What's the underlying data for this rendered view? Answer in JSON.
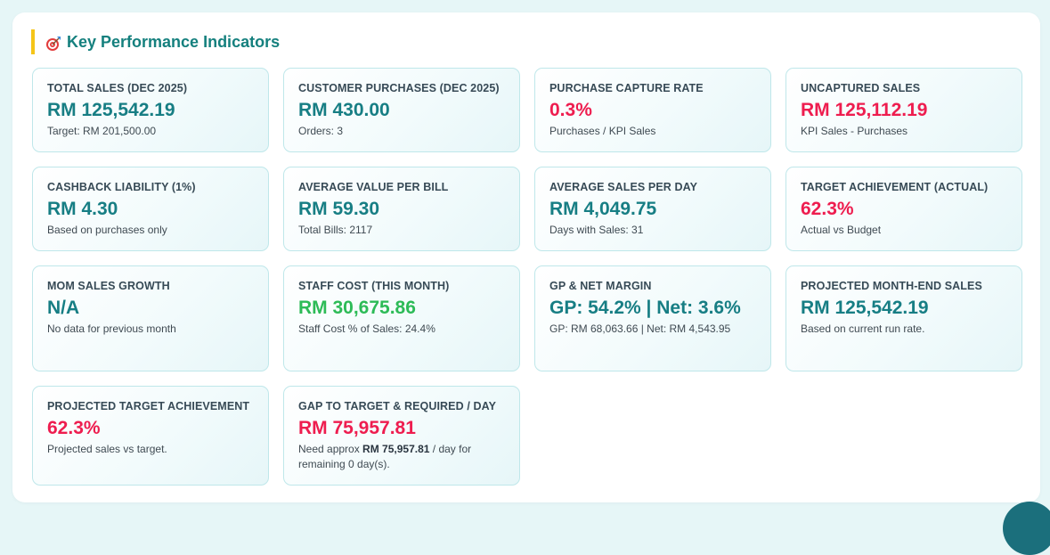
{
  "section": {
    "title": "Key Performance Indicators",
    "icon": "target-icon",
    "accent_color": "#f5c518"
  },
  "colors": {
    "teal": "#177e84",
    "red": "#ee1d4f",
    "green": "#2dbb57"
  },
  "cards": [
    {
      "label": "TOTAL SALES (DEC 2025)",
      "value": "RM 125,542.19",
      "sub": "Target: RM 201,500.00",
      "tone": "teal"
    },
    {
      "label": "CUSTOMER PURCHASES (DEC 2025)",
      "value": "RM 430.00",
      "sub": "Orders: 3",
      "tone": "teal"
    },
    {
      "label": "PURCHASE CAPTURE RATE",
      "value": "0.3%",
      "sub": "Purchases / KPI Sales",
      "tone": "red"
    },
    {
      "label": "UNCAPTURED SALES",
      "value": "RM 125,112.19",
      "sub": "KPI Sales - Purchases",
      "tone": "red"
    },
    {
      "label": "CASHBACK LIABILITY (1%)",
      "value": "RM 4.30",
      "sub": "Based on purchases only",
      "tone": "teal"
    },
    {
      "label": "AVERAGE VALUE PER BILL",
      "value": "RM 59.30",
      "sub": "Total Bills: 2117",
      "tone": "teal"
    },
    {
      "label": "AVERAGE SALES PER DAY",
      "value": "RM 4,049.75",
      "sub": "Days with Sales: 31",
      "tone": "teal"
    },
    {
      "label": "TARGET ACHIEVEMENT (ACTUAL)",
      "value": "62.3%",
      "sub": "Actual vs Budget",
      "tone": "red"
    },
    {
      "label": "MOM SALES GROWTH",
      "value": "N/A",
      "sub": "No data for previous month",
      "tone": "teal"
    },
    {
      "label": "STAFF COST (THIS MONTH)",
      "value": "RM 30,675.86",
      "sub": "Staff Cost % of Sales: 24.4%",
      "tone": "green"
    },
    {
      "label": "GP & NET MARGIN",
      "value": "GP: 54.2% | Net: 3.6%",
      "sub": "GP: RM 68,063.66 | Net: RM 4,543.95",
      "tone": "teal"
    },
    {
      "label": "PROJECTED MONTH-END SALES",
      "value": "RM 125,542.19",
      "sub": "Based on current run rate.",
      "tone": "teal"
    },
    {
      "label": "PROJECTED TARGET ACHIEVEMENT",
      "value": "62.3%",
      "sub": "Projected sales vs target.",
      "tone": "red"
    },
    {
      "label": "GAP TO TARGET & REQUIRED / DAY",
      "value": "RM 75,957.81",
      "sub_prefix": "Need approx ",
      "sub_bold": "RM 75,957.81",
      "sub_suffix": " / day for remaining 0 day(s).",
      "tone": "red"
    }
  ],
  "fab": {
    "icon": "floating-action-icon"
  }
}
